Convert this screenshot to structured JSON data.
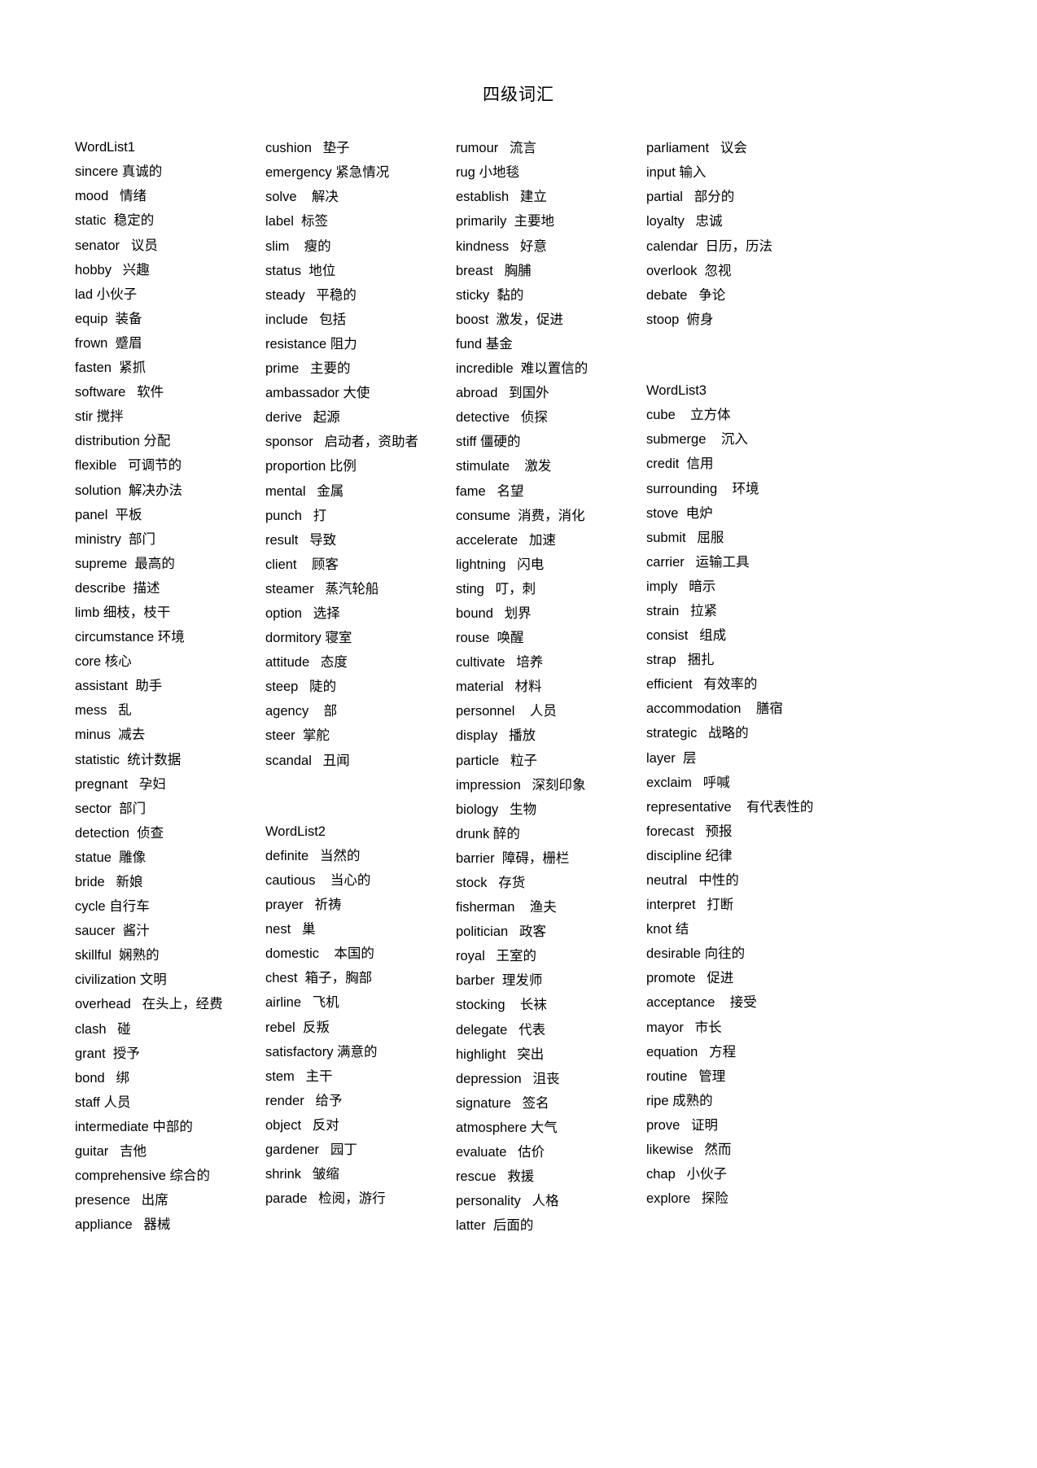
{
  "document": {
    "title": "四级词汇"
  },
  "columns": [
    {
      "id": "column-1",
      "entries": [
        {
          "en": "WordList1",
          "zh": "",
          "gap": " "
        },
        {
          "en": "sincere",
          "zh": "真诚的",
          "gap": " "
        },
        {
          "en": "mood",
          "zh": "情绪",
          "gap": "   "
        },
        {
          "en": "static",
          "zh": "稳定的",
          "gap": "  "
        },
        {
          "en": "senator",
          "zh": "议员",
          "gap": "   "
        },
        {
          "en": "hobby",
          "zh": "兴趣",
          "gap": "   "
        },
        {
          "en": "lad",
          "zh": "小伙子",
          "gap": " "
        },
        {
          "en": "equip",
          "zh": "装备",
          "gap": "  "
        },
        {
          "en": "frown",
          "zh": "蹙眉",
          "gap": "  "
        },
        {
          "en": "fasten",
          "zh": "紧抓",
          "gap": "  "
        },
        {
          "en": "software",
          "zh": "软件",
          "gap": "   "
        },
        {
          "en": "stir",
          "zh": "搅拌",
          "gap": " "
        },
        {
          "en": "distribution",
          "zh": "分配",
          "gap": " "
        },
        {
          "en": "flexible",
          "zh": "可调节的",
          "gap": "   "
        },
        {
          "en": "solution",
          "zh": "解决办法",
          "gap": "  "
        },
        {
          "en": "panel",
          "zh": "平板",
          "gap": "  "
        },
        {
          "en": "ministry",
          "zh": "部门",
          "gap": "  "
        },
        {
          "en": "supreme",
          "zh": "最高的",
          "gap": "  "
        },
        {
          "en": "describe",
          "zh": "描述",
          "gap": "  "
        },
        {
          "en": "limb",
          "zh": "细枝，枝干",
          "gap": " "
        },
        {
          "en": "circumstance",
          "zh": "环境",
          "gap": " "
        },
        {
          "en": "core",
          "zh": "核心",
          "gap": " "
        },
        {
          "en": "assistant",
          "zh": "助手",
          "gap": "  "
        },
        {
          "en": "mess",
          "zh": "乱",
          "gap": "   "
        },
        {
          "en": "minus",
          "zh": "减去",
          "gap": "  "
        },
        {
          "en": "statistic",
          "zh": "统计数据",
          "gap": "  "
        },
        {
          "en": "pregnant",
          "zh": "孕妇",
          "gap": "   "
        },
        {
          "en": "sector",
          "zh": "部门",
          "gap": "  "
        },
        {
          "en": "detection",
          "zh": "侦查",
          "gap": "  "
        },
        {
          "en": "statue",
          "zh": "雕像",
          "gap": "  "
        },
        {
          "en": "bride",
          "zh": "新娘",
          "gap": "   "
        },
        {
          "en": "cycle",
          "zh": "自行车",
          "gap": " "
        },
        {
          "en": "saucer",
          "zh": "酱汁",
          "gap": "  "
        },
        {
          "en": "skillful",
          "zh": "娴熟的",
          "gap": "  "
        },
        {
          "en": "civilization",
          "zh": "文明",
          "gap": " "
        },
        {
          "en": "overhead",
          "zh": "在头上，经费",
          "gap": "   "
        },
        {
          "en": "clash",
          "zh": "碰",
          "gap": "   "
        },
        {
          "en": "grant",
          "zh": "授予",
          "gap": "  "
        },
        {
          "en": "bond",
          "zh": "绑",
          "gap": "   "
        },
        {
          "en": "staff",
          "zh": "人员",
          "gap": " "
        },
        {
          "en": "intermediate",
          "zh": "中部的",
          "gap": " "
        },
        {
          "en": "guitar",
          "zh": "吉他",
          "gap": "   "
        },
        {
          "en": "comprehensive",
          "zh": "综合的",
          "gap": " "
        },
        {
          "en": "presence",
          "zh": "出席",
          "gap": "   "
        },
        {
          "en": "appliance",
          "zh": "器械",
          "gap": "   "
        }
      ]
    },
    {
      "id": "column-2",
      "entries": [
        {
          "en": "cushion",
          "zh": "垫子",
          "gap": "   "
        },
        {
          "en": "emergency",
          "zh": "紧急情况",
          "gap": " "
        },
        {
          "en": "solve",
          "zh": "解决",
          "gap": "    "
        },
        {
          "en": "label",
          "zh": "标签",
          "gap": "  "
        },
        {
          "en": "slim",
          "zh": "瘦的",
          "gap": "    "
        },
        {
          "en": "status",
          "zh": "地位",
          "gap": "  "
        },
        {
          "en": "steady",
          "zh": "平稳的",
          "gap": "   "
        },
        {
          "en": "include",
          "zh": "包括",
          "gap": "   "
        },
        {
          "en": "resistance",
          "zh": "阻力",
          "gap": " "
        },
        {
          "en": "prime",
          "zh": "主要的",
          "gap": "   "
        },
        {
          "en": "ambassador",
          "zh": "大使",
          "gap": " "
        },
        {
          "en": "derive",
          "zh": "起源",
          "gap": "   "
        },
        {
          "en": "sponsor",
          "zh": "启动者，资助者",
          "gap": "   "
        },
        {
          "en": "proportion",
          "zh": "比例",
          "gap": " "
        },
        {
          "en": "mental",
          "zh": "金属",
          "gap": "   "
        },
        {
          "en": "punch",
          "zh": "打",
          "gap": "   "
        },
        {
          "en": "result",
          "zh": "导致",
          "gap": "   "
        },
        {
          "en": "client",
          "zh": "顾客",
          "gap": "    "
        },
        {
          "en": "steamer",
          "zh": "蒸汽轮船",
          "gap": "   "
        },
        {
          "en": "option",
          "zh": "选择",
          "gap": "   "
        },
        {
          "en": "dormitory",
          "zh": "寝室",
          "gap": " "
        },
        {
          "en": "attitude",
          "zh": "态度",
          "gap": "   "
        },
        {
          "en": "steep",
          "zh": "陡的",
          "gap": "   "
        },
        {
          "en": "agency",
          "zh": "部",
          "gap": "    "
        },
        {
          "en": "steer",
          "zh": "掌舵",
          "gap": "  "
        },
        {
          "en": "scandal",
          "zh": "丑闻",
          "gap": "   "
        },
        {
          "en": "",
          "zh": "",
          "gap": ""
        },
        {
          "en": "",
          "zh": "",
          "gap": ""
        },
        {
          "en": "WordList2",
          "zh": "",
          "gap": ""
        },
        {
          "en": "definite",
          "zh": "当然的",
          "gap": "   "
        },
        {
          "en": "cautious",
          "zh": "当心的",
          "gap": "    "
        },
        {
          "en": "prayer",
          "zh": "祈祷",
          "gap": "   "
        },
        {
          "en": "nest",
          "zh": "巢",
          "gap": "   "
        },
        {
          "en": "domestic",
          "zh": "本国的",
          "gap": "    "
        },
        {
          "en": "chest",
          "zh": "箱子，胸部",
          "gap": "  "
        },
        {
          "en": "airline",
          "zh": "飞机",
          "gap": "   "
        },
        {
          "en": "rebel",
          "zh": "反叛",
          "gap": "  "
        },
        {
          "en": "satisfactory",
          "zh": "满意的",
          "gap": " "
        },
        {
          "en": "stem",
          "zh": "主干",
          "gap": "   "
        },
        {
          "en": "render",
          "zh": "给予",
          "gap": "   "
        },
        {
          "en": "object",
          "zh": "反对",
          "gap": "   "
        },
        {
          "en": "gardener",
          "zh": "园丁",
          "gap": "   "
        },
        {
          "en": "shrink",
          "zh": "皱缩",
          "gap": "   "
        },
        {
          "en": "parade",
          "zh": "检阅，游行",
          "gap": "   "
        }
      ]
    },
    {
      "id": "column-3",
      "entries": [
        {
          "en": "rumour",
          "zh": "流言",
          "gap": "   "
        },
        {
          "en": "rug",
          "zh": "小地毯",
          "gap": " "
        },
        {
          "en": "establish",
          "zh": "建立",
          "gap": "   "
        },
        {
          "en": "primarily",
          "zh": "主要地",
          "gap": "  "
        },
        {
          "en": "kindness",
          "zh": "好意",
          "gap": "   "
        },
        {
          "en": "breast",
          "zh": "胸脯",
          "gap": "   "
        },
        {
          "en": "sticky",
          "zh": "黏的",
          "gap": "  "
        },
        {
          "en": "boost",
          "zh": "激发，促进",
          "gap": "  "
        },
        {
          "en": "fund",
          "zh": "基金",
          "gap": " "
        },
        {
          "en": "incredible",
          "zh": "难以置信的",
          "gap": "  "
        },
        {
          "en": "abroad",
          "zh": "到国外",
          "gap": "   "
        },
        {
          "en": "detective",
          "zh": "侦探",
          "gap": "   "
        },
        {
          "en": "stiff",
          "zh": "僵硬的",
          "gap": " "
        },
        {
          "en": "stimulate",
          "zh": "激发",
          "gap": "    "
        },
        {
          "en": "fame",
          "zh": "名望",
          "gap": "   "
        },
        {
          "en": "consume",
          "zh": "消费，消化",
          "gap": "  "
        },
        {
          "en": "accelerate",
          "zh": "加速",
          "gap": "   "
        },
        {
          "en": "lightning",
          "zh": "闪电",
          "gap": "   "
        },
        {
          "en": "sting",
          "zh": "叮，刺",
          "gap": "   "
        },
        {
          "en": "bound",
          "zh": "划界",
          "gap": "   "
        },
        {
          "en": "rouse",
          "zh": "唤醒",
          "gap": "  "
        },
        {
          "en": "cultivate",
          "zh": "培养",
          "gap": "   "
        },
        {
          "en": "material",
          "zh": "材料",
          "gap": "   "
        },
        {
          "en": "personnel",
          "zh": "人员",
          "gap": "    "
        },
        {
          "en": "display",
          "zh": "播放",
          "gap": "   "
        },
        {
          "en": "particle",
          "zh": "粒子",
          "gap": "   "
        },
        {
          "en": "impression",
          "zh": "深刻印象",
          "gap": "   "
        },
        {
          "en": "biology",
          "zh": "生物",
          "gap": "   "
        },
        {
          "en": "drunk",
          "zh": "醉的",
          "gap": " "
        },
        {
          "en": "barrier",
          "zh": "障碍，栅栏",
          "gap": "  "
        },
        {
          "en": "stock",
          "zh": "存货",
          "gap": "   "
        },
        {
          "en": "fisherman",
          "zh": "渔夫",
          "gap": "    "
        },
        {
          "en": "politician",
          "zh": "政客",
          "gap": "   "
        },
        {
          "en": "royal",
          "zh": "王室的",
          "gap": "   "
        },
        {
          "en": "barber",
          "zh": "理发师",
          "gap": "  "
        },
        {
          "en": "stocking",
          "zh": "长袜",
          "gap": "    "
        },
        {
          "en": "delegate",
          "zh": "代表",
          "gap": "   "
        },
        {
          "en": "highlight",
          "zh": "突出",
          "gap": "   "
        },
        {
          "en": "depression",
          "zh": "沮丧",
          "gap": "   "
        },
        {
          "en": "signature",
          "zh": "签名",
          "gap": "   "
        },
        {
          "en": "atmosphere",
          "zh": "大气",
          "gap": " "
        },
        {
          "en": "evaluate",
          "zh": "估价",
          "gap": "   "
        },
        {
          "en": "rescue",
          "zh": "救援",
          "gap": "   "
        },
        {
          "en": "personality",
          "zh": "人格",
          "gap": "   "
        },
        {
          "en": "latter",
          "zh": "后面的",
          "gap": "  "
        }
      ]
    },
    {
      "id": "column-4",
      "entries": [
        {
          "en": "parliament",
          "zh": "议会",
          "gap": "   "
        },
        {
          "en": "input",
          "zh": "输入",
          "gap": " "
        },
        {
          "en": "partial",
          "zh": "部分的",
          "gap": "   "
        },
        {
          "en": "loyalty",
          "zh": "忠诚",
          "gap": "   "
        },
        {
          "en": "calendar",
          "zh": "日历，历法",
          "gap": "  "
        },
        {
          "en": "overlook",
          "zh": "忽视",
          "gap": "  "
        },
        {
          "en": "debate",
          "zh": "争论",
          "gap": "   "
        },
        {
          "en": "stoop",
          "zh": "俯身",
          "gap": "  "
        },
        {
          "en": "",
          "zh": "",
          "gap": ""
        },
        {
          "en": "",
          "zh": "",
          "gap": ""
        },
        {
          "en": "WordList3",
          "zh": "",
          "gap": ""
        },
        {
          "en": "cube",
          "zh": "立方体",
          "gap": "    "
        },
        {
          "en": "submerge",
          "zh": "沉入",
          "gap": "    "
        },
        {
          "en": "credit",
          "zh": "信用",
          "gap": "  "
        },
        {
          "en": "surrounding",
          "zh": "环境",
          "gap": "    "
        },
        {
          "en": "stove",
          "zh": "电炉",
          "gap": "  "
        },
        {
          "en": "submit",
          "zh": "屈服",
          "gap": "   "
        },
        {
          "en": "carrier",
          "zh": "运输工具",
          "gap": "   "
        },
        {
          "en": "imply",
          "zh": "暗示",
          "gap": "   "
        },
        {
          "en": "strain",
          "zh": "拉紧",
          "gap": "   "
        },
        {
          "en": "consist",
          "zh": "组成",
          "gap": "   "
        },
        {
          "en": "strap",
          "zh": "捆扎",
          "gap": "   "
        },
        {
          "en": "efficient",
          "zh": "有效率的",
          "gap": "   "
        },
        {
          "en": "accommodation",
          "zh": "膳宿",
          "gap": "    "
        },
        {
          "en": "strategic",
          "zh": "战略的",
          "gap": "   "
        },
        {
          "en": "layer",
          "zh": "层",
          "gap": "  "
        },
        {
          "en": "exclaim",
          "zh": "呼喊",
          "gap": "   "
        },
        {
          "en": "representative",
          "zh": "有代表性的",
          "gap": "    "
        },
        {
          "en": "forecast",
          "zh": "预报",
          "gap": "   "
        },
        {
          "en": "discipline",
          "zh": "纪律",
          "gap": " "
        },
        {
          "en": "neutral",
          "zh": "中性的",
          "gap": "   "
        },
        {
          "en": "interpret",
          "zh": "打断",
          "gap": "   "
        },
        {
          "en": "knot",
          "zh": "结",
          "gap": " "
        },
        {
          "en": "desirable",
          "zh": "向往的",
          "gap": " "
        },
        {
          "en": "promote",
          "zh": "促进",
          "gap": "   "
        },
        {
          "en": "acceptance",
          "zh": "接受",
          "gap": "    "
        },
        {
          "en": "mayor",
          "zh": "市长",
          "gap": "   "
        },
        {
          "en": "equation",
          "zh": "方程",
          "gap": "   "
        },
        {
          "en": "routine",
          "zh": "管理",
          "gap": "   "
        },
        {
          "en": "ripe",
          "zh": "成熟的",
          "gap": " "
        },
        {
          "en": "prove",
          "zh": "证明",
          "gap": "   "
        },
        {
          "en": "likewise",
          "zh": "然而",
          "gap": "   "
        },
        {
          "en": "chap",
          "zh": "小伙子",
          "gap": "   "
        },
        {
          "en": "explore",
          "zh": "探险",
          "gap": "   "
        }
      ]
    }
  ]
}
